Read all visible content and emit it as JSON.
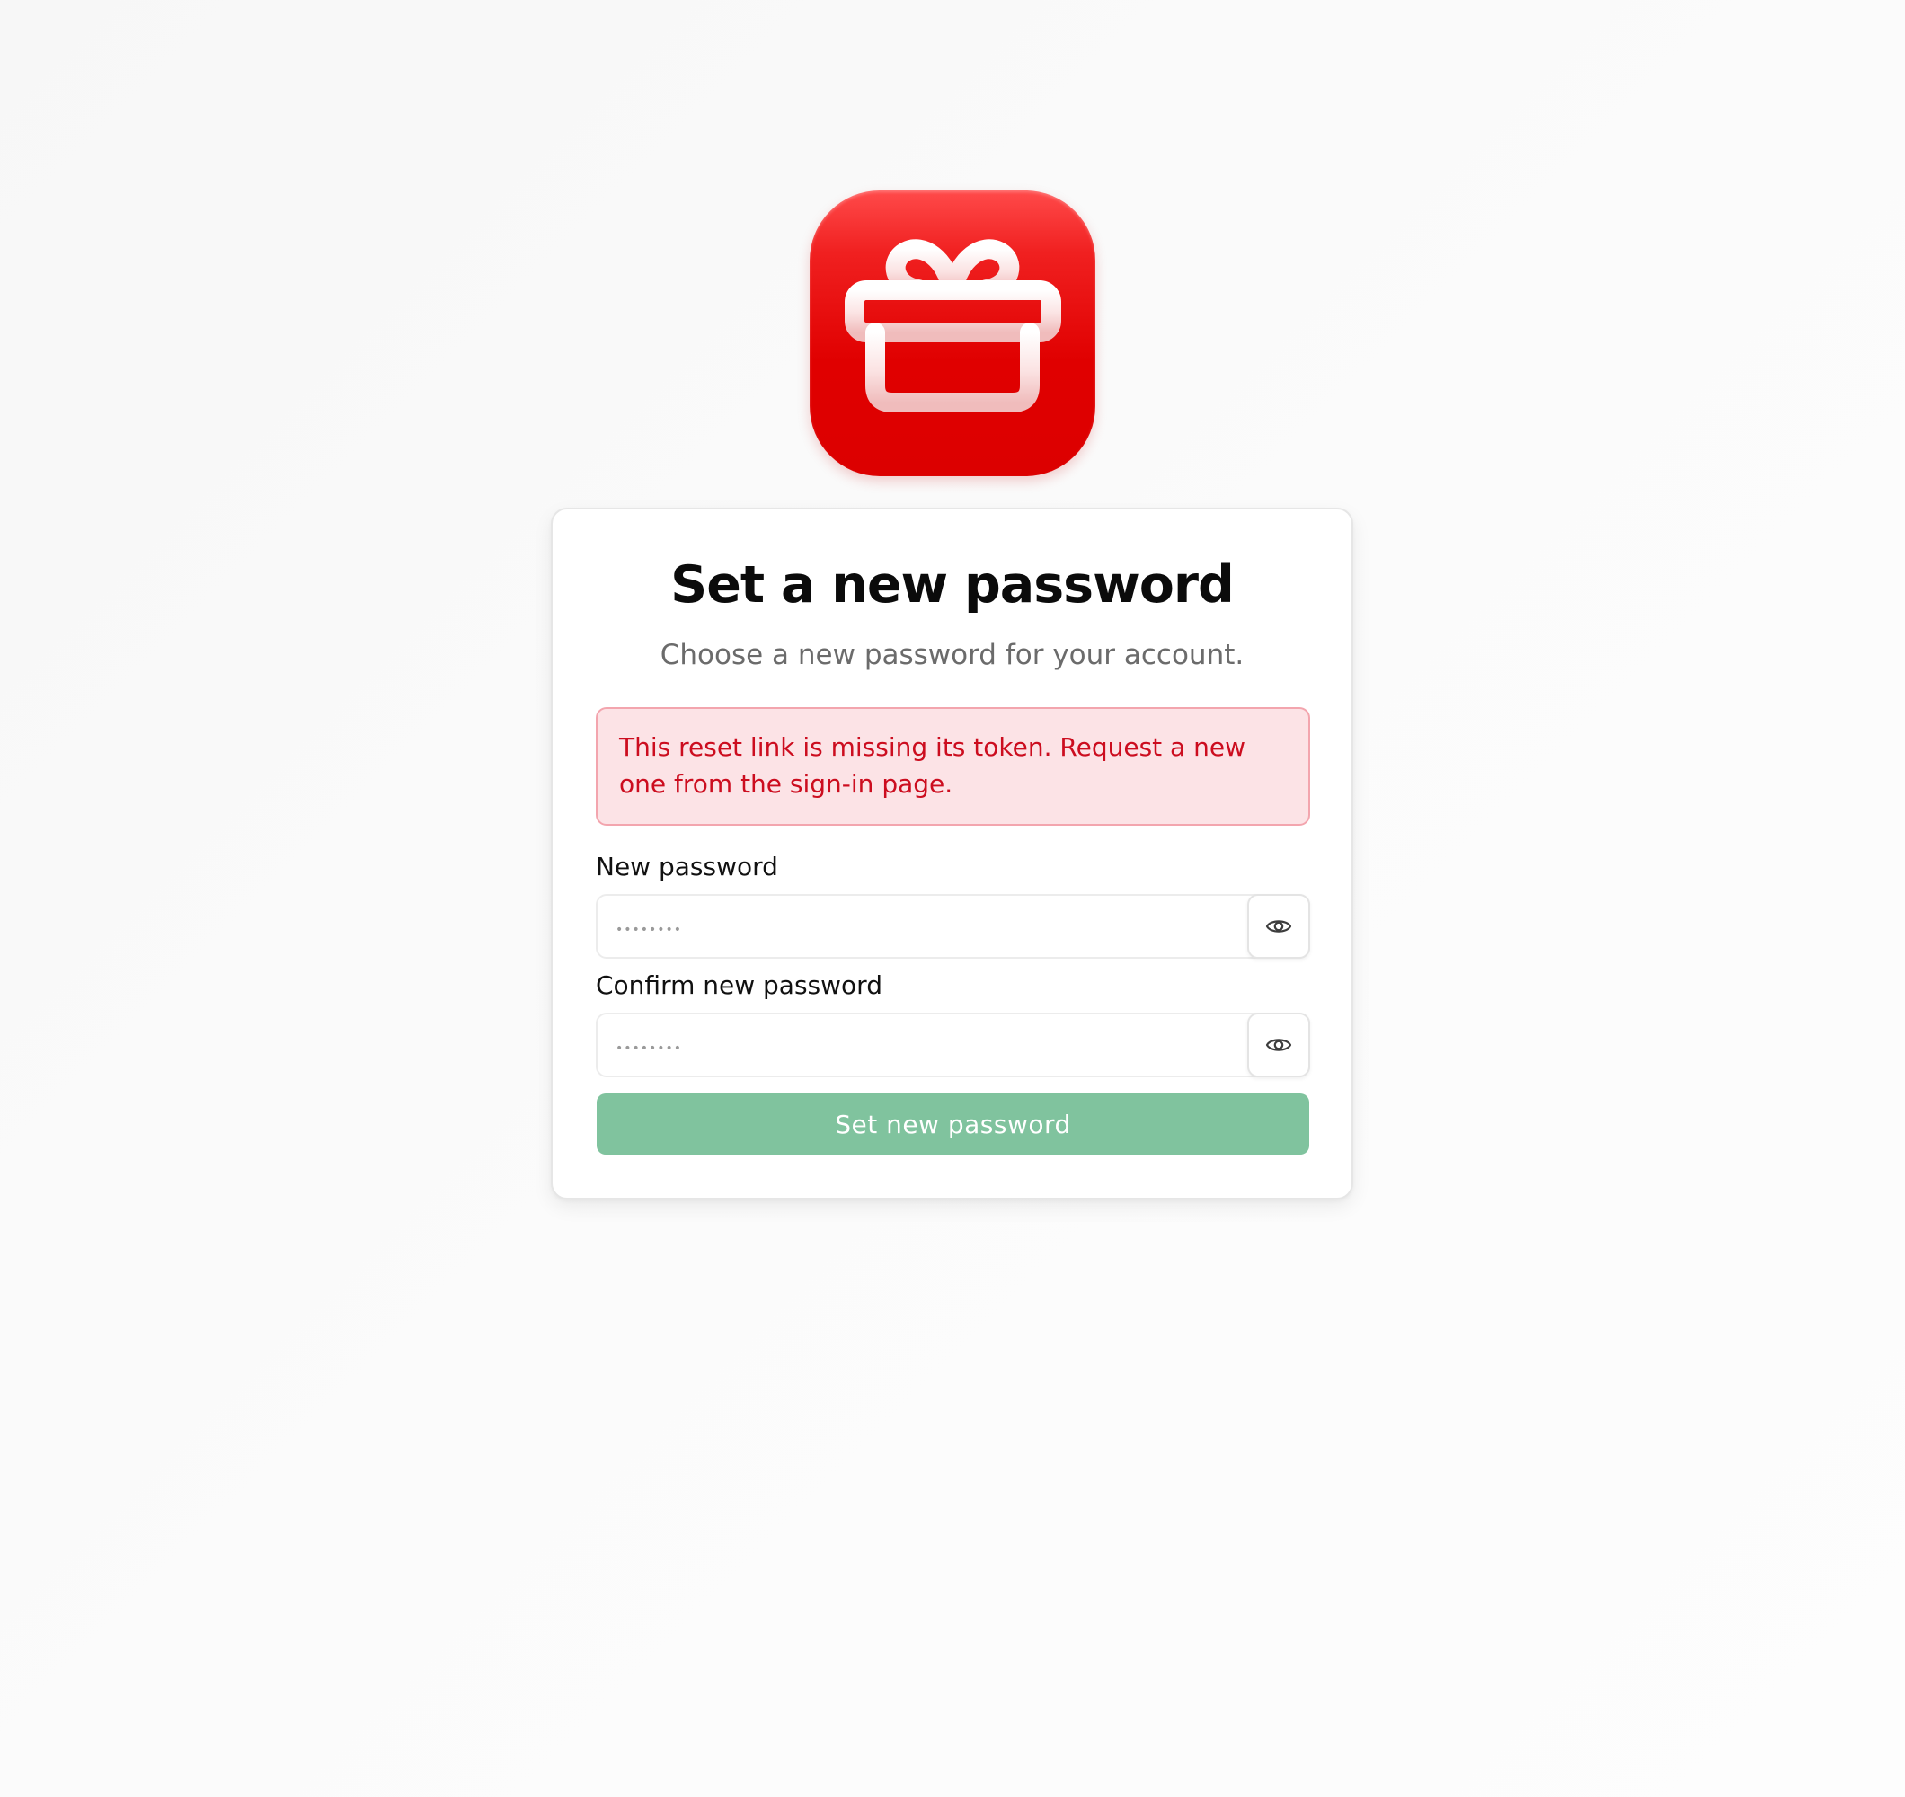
{
  "app": {
    "logo_icon": "gift-icon",
    "brand_color": "#e00000"
  },
  "card": {
    "title": "Set a new password",
    "subtitle": "Choose a new password for your account."
  },
  "alert": {
    "message": "This reset link is missing its token. Request a new one from the sign-in page.",
    "text_color": "#cc0d1f",
    "background_color": "#fce3e6"
  },
  "fields": {
    "new_password": {
      "label": "New password",
      "placeholder": "••••••••",
      "value": "",
      "toggle_icon": "eye-icon"
    },
    "confirm_password": {
      "label": "Confirm new password",
      "placeholder": "••••••••",
      "value": "",
      "toggle_icon": "eye-icon"
    }
  },
  "submit": {
    "label": "Set new password",
    "color": "#80c39e"
  }
}
